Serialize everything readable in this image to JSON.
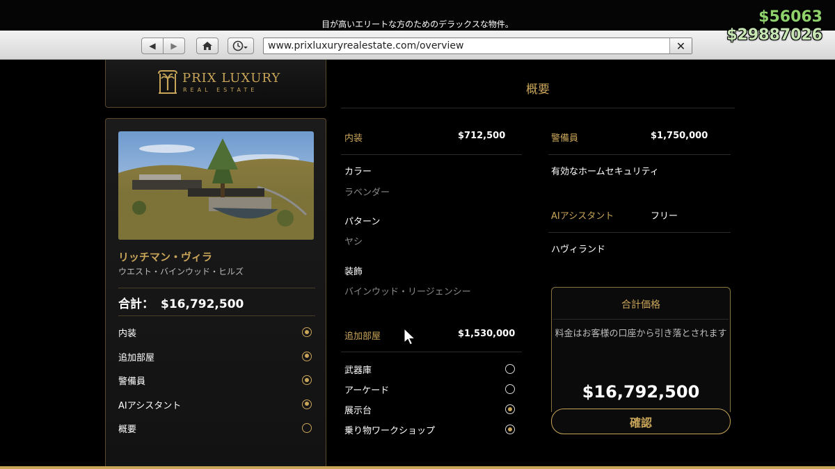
{
  "page": {
    "subtitle": "目が高いエリートな方のためのデラックスな物件。"
  },
  "browser": {
    "url": "www.prixluxuryrealestate.com/overview",
    "back_icon": "back-arrow-icon",
    "forward_icon": "forward-arrow-icon",
    "home_icon": "home-icon",
    "history_icon": "history-icon",
    "close_icon": "close-icon"
  },
  "hud": {
    "cash": "$56063",
    "bank": "$29887026"
  },
  "brand": {
    "name": "PRIX LUXURY",
    "sub": "REAL ESTATE"
  },
  "property": {
    "name": "リッチマン・ヴィラ",
    "location": "ウエスト・バインウッド・ヒルズ",
    "total_label": "合計：",
    "total_value": "$16,792,500"
  },
  "menu": [
    {
      "label": "内装",
      "selected": true
    },
    {
      "label": "追加部屋",
      "selected": true
    },
    {
      "label": "警備員",
      "selected": true
    },
    {
      "label": "AIアシスタント",
      "selected": true
    },
    {
      "label": "概要",
      "selected": false
    }
  ],
  "overview": {
    "title": "概要",
    "interior": {
      "label": "内装",
      "price": "$712,500",
      "color_label": "カラー",
      "color_value": "ラベンダー",
      "pattern_label": "パターン",
      "pattern_value": "ヤシ",
      "decor_label": "装飾",
      "decor_value": "バインウッド・リージェンシー"
    },
    "rooms": {
      "label": "追加部屋",
      "price": "$1,530,000",
      "options": [
        {
          "label": "武器庫",
          "selected": false
        },
        {
          "label": "アーケード",
          "selected": false
        },
        {
          "label": "展示台",
          "selected": true
        },
        {
          "label": "乗り物ワークショップ",
          "selected": true
        }
      ]
    },
    "security": {
      "label": "警備員",
      "price": "$1,750,000",
      "value": "有効なホームセキュリティ"
    },
    "ai": {
      "label": "AIアシスタント",
      "price": "フリー",
      "value": "ハヴィランド"
    }
  },
  "summary": {
    "title": "合計価格",
    "note": "料金はお客様の口座から引き落とされます",
    "price": "$16,792,500",
    "confirm_label": "確認"
  },
  "colors": {
    "accent_gold": "#c9a559",
    "cash_green": "#8fd16b"
  }
}
